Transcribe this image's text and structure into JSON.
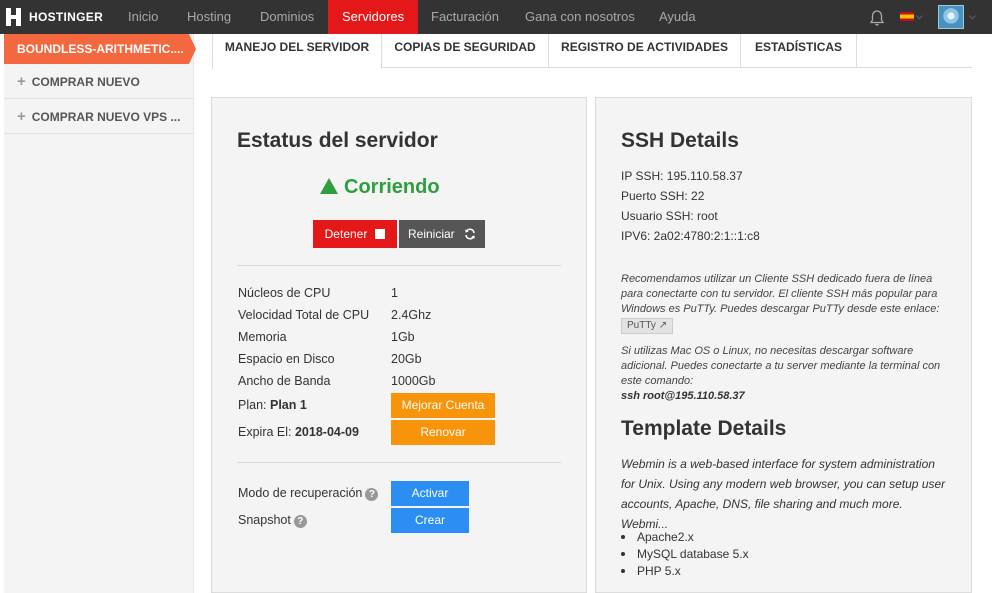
{
  "brand": {
    "logo_text": "HOSTINGER"
  },
  "nav": {
    "items": [
      "Inicio",
      "Hosting",
      "Dominios",
      "Servidores",
      "Facturación",
      "Gana con nosotros",
      "Ayuda"
    ],
    "active": "Servidores",
    "language_flag": "es",
    "icons": [
      "bell-icon",
      "chevron-down-icon",
      "avatar"
    ]
  },
  "sidebar": {
    "active_server": "BOUNDLESS-ARITHMETIC....",
    "items": [
      {
        "label": "COMPRAR NUEVO",
        "icon": "plus-icon"
      },
      {
        "label": "COMPRAR NUEVO VPS ...",
        "icon": "plus-icon"
      }
    ]
  },
  "tabs": [
    "MANEJO DEL SERVIDOR",
    "COPIAS DE SEGURIDAD",
    "REGISTRO DE ACTIVIDADES",
    "ESTADÍSTICAS"
  ],
  "active_tab": "MANEJO DEL SERVIDOR",
  "server_status": {
    "title": "Estatus del servidor",
    "status": "Corriendo",
    "stop_label": "Detener",
    "restart_label": "Reiniciar",
    "specs": [
      {
        "label": "Núcleos de CPU",
        "value": "1"
      },
      {
        "label": "Velocidad Total de CPU",
        "value": "2.4Ghz"
      },
      {
        "label": "Memoria",
        "value": "1Gb"
      },
      {
        "label": "Espacio en Disco",
        "value": "20Gb"
      },
      {
        "label": "Ancho de Banda",
        "value": "1000Gb"
      }
    ],
    "plan_label": "Plan:",
    "plan_value": "Plan 1",
    "upgrade_label": "Mejorar Cuenta",
    "expires_label": "Expira El:",
    "expires_value": "2018-04-09",
    "renew_label": "Renovar",
    "recovery_label": "Modo de recuperación",
    "recovery_button": "Activar",
    "snapshot_label": "Snapshot",
    "snapshot_button": "Crear"
  },
  "ssh": {
    "title": "SSH Details",
    "ip": "IP SSH: 195.110.58.37",
    "port": "Puerto SSH: 22",
    "user": "Usuario SSH: root",
    "ipv6": "IPV6: 2a02:4780:2:1::1:c8",
    "recommend_text": "Recomendamos utilizar un Cliente SSH dedicado fuera de línea para conectarte con tu servidor. El cliente SSH más popular para Windows es PuTTy. Puedes descargar PuTTy desde este enlace:",
    "putty_link": "PuTTy",
    "mac_text": "Si utilizas Mac OS o Linux, no necesitas descargar software adicional. Puedes conectarte a tu server mediante la terminal con este comando:",
    "command": "ssh root@195.110.58.37"
  },
  "template": {
    "title": "Template Details",
    "description": "Webmin is a web-based interface for system administration for Unix. Using any modern web browser, you can setup user accounts, Apache, DNS, file sharing and much more. Webmi...",
    "packages": [
      "Apache2.x",
      "MySQL database 5.x",
      "PHP 5.x"
    ]
  },
  "colors": {
    "nav_bg": "#333333",
    "nav_active": "#e41818",
    "sidebar_active": "#f4683f",
    "status_green": "#2e9e3f",
    "orange": "#f7940a",
    "blue": "#2c8ef3"
  }
}
